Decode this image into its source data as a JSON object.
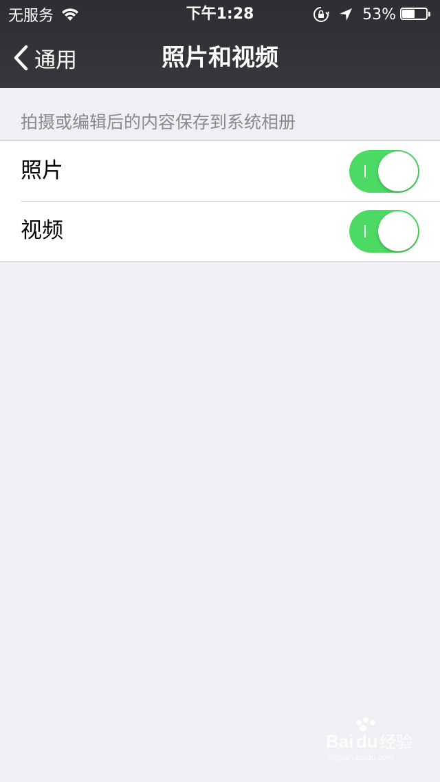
{
  "status_bar": {
    "carrier": "无服务",
    "time": "下午1:28",
    "battery_percent": "53%",
    "battery_level": 0.53,
    "icons": [
      "wifi-icon",
      "lock-rotate-icon",
      "location-icon",
      "battery-icon"
    ]
  },
  "nav_bar": {
    "back_label": "通用",
    "title": "照片和视频"
  },
  "section": {
    "header": "拍摄或编辑后的内容保存到系统相册",
    "rows": [
      {
        "label": "照片",
        "toggle_on": true
      },
      {
        "label": "视频",
        "toggle_on": true
      }
    ]
  },
  "colors": {
    "header_bg": "#2e2d33",
    "page_bg": "#efeff4",
    "toggle_on": "#4cd964",
    "section_header_text": "#8a8a8f"
  },
  "watermark": {
    "brand": "Baidu经验",
    "sub": "jingyan.baidu.com"
  }
}
